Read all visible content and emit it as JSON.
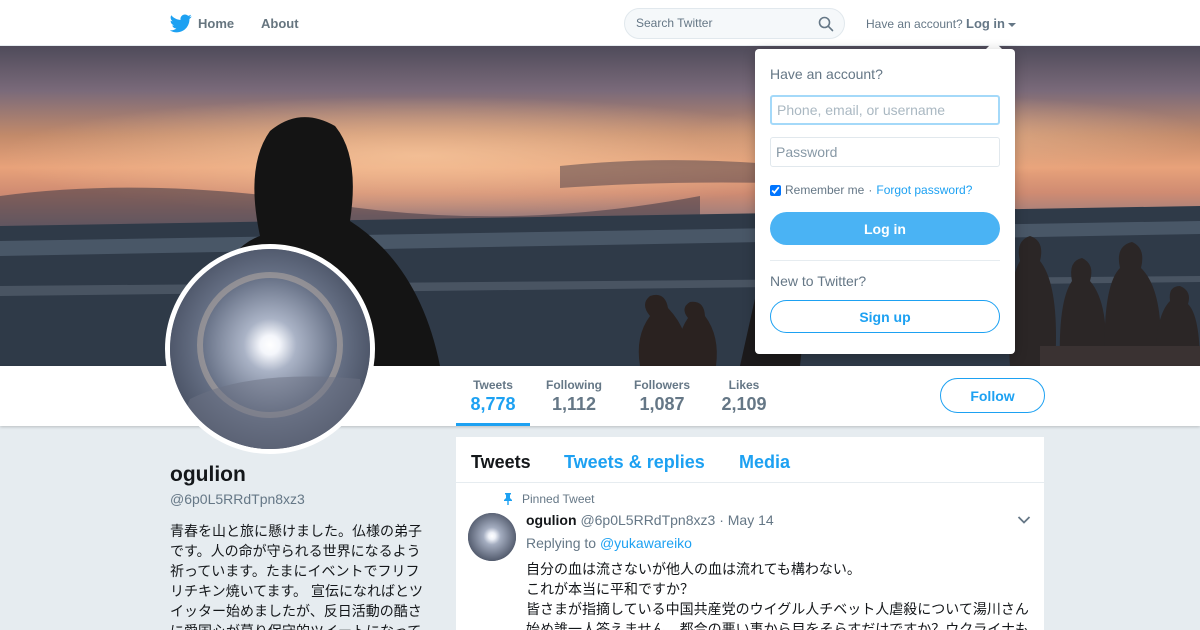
{
  "colors": {
    "accent": "#1da1f2",
    "login_button": "#4ab3f4",
    "muted_text": "#657786",
    "page_background": "#e6ecf0"
  },
  "nav": {
    "logo_icon": "twitter-bird-icon",
    "home_label": "Home",
    "about_label": "About",
    "search_placeholder": "Search Twitter",
    "search_icon": "search-icon",
    "have_account_text": "Have an account?",
    "login_label": "Log in"
  },
  "profile": {
    "name": "ogulion",
    "handle": "@6p0L5RRdTpn8xz3",
    "bio": "青春を山と旅に懸けました。仏様の弟子です。人の命が守られる世界になるよう祈っています。たまにイベントでフリフリチキン焼いてます。 宣伝になればとツイッター始めましたが、反日活動の酷さに愛国心が募り保守的ツイートになって"
  },
  "stats": [
    {
      "label": "Tweets",
      "value": "8,778",
      "active": true
    },
    {
      "label": "Following",
      "value": "1,112",
      "active": false
    },
    {
      "label": "Followers",
      "value": "1,087",
      "active": false
    },
    {
      "label": "Likes",
      "value": "2,109",
      "active": false
    }
  ],
  "follow_label": "Follow",
  "timeline": {
    "tabs": [
      "Tweets",
      "Tweets & replies",
      "Media"
    ],
    "active_tab": "Tweets",
    "pinned": {
      "label": "Pinned Tweet",
      "name": "ogulion",
      "handle": "@6p0L5RRdTpn8xz3",
      "date": "May 14",
      "replying_prefix": "Replying to",
      "replying_to": "@yukawareiko",
      "lines": [
        "自分の血は流さないが他人の血は流れても構わない。",
        "これが本当に平和ですか？",
        "皆さまが指摘している中国共産党のウイグル人チベット人虐殺について湯川さん",
        "始め誰一人答えません。都合の悪い事から目をそらすだけですか？ウクライナも"
      ]
    }
  },
  "login_dropdown": {
    "heading": "Have an account?",
    "username_placeholder": "Phone, email, or username",
    "password_placeholder": "Password",
    "remember_label": "Remember me",
    "remember_checked": true,
    "separator": "·",
    "forgot_label": "Forgot password?",
    "login_button": "Log in",
    "new_prompt": "New to Twitter?",
    "signup_button": "Sign up"
  }
}
